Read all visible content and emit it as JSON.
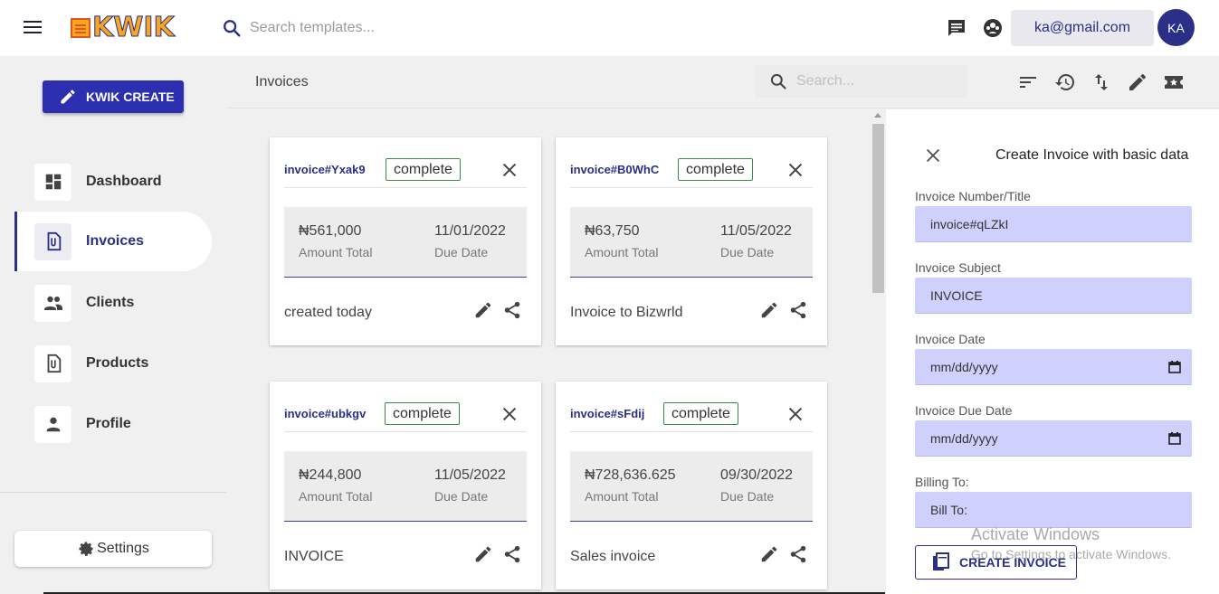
{
  "header": {
    "logo_text": "KWIK",
    "search_placeholder": "Search templates...",
    "email": "ka@gmail.com",
    "avatar_initials": "KA",
    "icons": [
      "menu-icon",
      "chat-icon",
      "support-icon"
    ]
  },
  "sidebar": {
    "create_label": "KWIK CREATE",
    "items": [
      {
        "label": "Dashboard",
        "icon": "dashboard-icon",
        "active": false
      },
      {
        "label": "Invoices",
        "icon": "invoice-icon",
        "active": true
      },
      {
        "label": "Clients",
        "icon": "people-icon",
        "active": false
      },
      {
        "label": "Products",
        "icon": "product-icon",
        "active": false
      },
      {
        "label": "Profile",
        "icon": "person-icon",
        "active": false
      }
    ],
    "settings_label": "Settings"
  },
  "main": {
    "title": "Invoices",
    "search_placeholder": "Search...",
    "toolbar_icons": [
      "sort-icon",
      "history-icon",
      "swap-icon",
      "edit-icon",
      "ticket-star-icon"
    ]
  },
  "invoices": [
    {
      "id": "invoice#Yxak9",
      "status": "complete",
      "amount": "₦561,000",
      "amount_label": "Amount Total",
      "due": "11/01/2022",
      "due_label": "Due Date",
      "description": "created today"
    },
    {
      "id": "invoice#B0WhC",
      "status": "complete",
      "amount": "₦63,750",
      "amount_label": "Amount Total",
      "due": "11/05/2022",
      "due_label": "Due Date",
      "description": "Invoice to Bizwrld"
    },
    {
      "id": "invoice#ubkgv",
      "status": "complete",
      "amount": "₦244,800",
      "amount_label": "Amount Total",
      "due": "11/05/2022",
      "due_label": "Due Date",
      "description": "INVOICE"
    },
    {
      "id": "invoice#sFdij",
      "status": "complete",
      "amount": "₦728,636.625",
      "amount_label": "Amount Total",
      "due": "09/30/2022",
      "due_label": "Due Date",
      "description": "Sales invoice"
    }
  ],
  "panel": {
    "title": "Create Invoice with basic data",
    "number_label": "Invoice Number/Title",
    "number_value": "invoice#qLZkI",
    "subject_label": "Invoice Subject",
    "subject_value": "INVOICE",
    "date_label": "Invoice Date",
    "date_placeholder": "mm/dd/yyyy",
    "due_label": "Invoice Due Date",
    "due_placeholder": "mm/dd/yyyy",
    "billing_label": "Billing To:",
    "billing_value": "Bill To:",
    "create_label": "CREATE INVOICE"
  },
  "watermark": {
    "title": "Activate Windows",
    "subtitle": "Go to Settings to activate Windows."
  },
  "colors": {
    "primary": "#2b2f86",
    "accent_button": "#2b2fb0",
    "field_bg": "#cfd0fb",
    "badge_border": "#3a8a4a",
    "logo_orange": "#f5a623"
  }
}
